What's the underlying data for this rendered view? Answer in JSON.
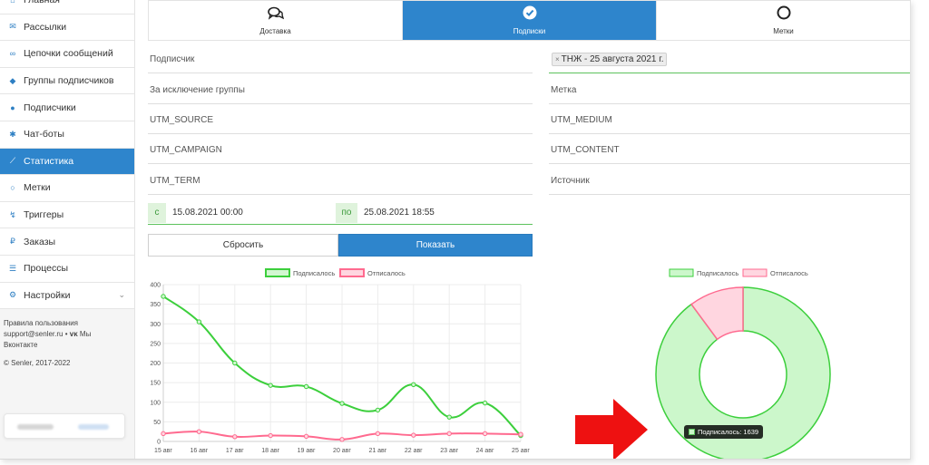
{
  "sidebar": {
    "items": [
      {
        "label": "Главная",
        "icon": "home-icon",
        "glyph": "⌂"
      },
      {
        "label": "Рассылки",
        "icon": "envelope-icon",
        "glyph": "✉"
      },
      {
        "label": "Цепочки сообщений",
        "icon": "link-icon",
        "glyph": "∞"
      },
      {
        "label": "Группы подписчиков",
        "icon": "tags-icon",
        "glyph": "◆"
      },
      {
        "label": "Подписчики",
        "icon": "users-icon",
        "glyph": "●"
      },
      {
        "label": "Чат-боты",
        "icon": "bot-icon",
        "glyph": "✱"
      },
      {
        "label": "Статистика",
        "icon": "chart-line-icon",
        "glyph": "⟋"
      },
      {
        "label": "Метки",
        "icon": "circle-icon",
        "glyph": "○"
      },
      {
        "label": "Триггеры",
        "icon": "bolt-icon",
        "glyph": "↯"
      },
      {
        "label": "Заказы",
        "icon": "ruble-icon",
        "glyph": "₽"
      },
      {
        "label": "Процессы",
        "icon": "list-icon",
        "glyph": "☰"
      },
      {
        "label": "Настройки",
        "icon": "gear-icon",
        "glyph": "⚙"
      }
    ],
    "settings_chevron": "⌄",
    "footer": {
      "terms": "Правила пользования",
      "support": "support@senler.ru",
      "vk_sep": " • ",
      "vk_icon": "vk-icon",
      "vk_text": "Мы",
      "vk_text2": "Вконтакте",
      "copyright": "© Senler, 2017-2022"
    }
  },
  "tabs": [
    {
      "label": "Доставка",
      "icon": "comments-icon",
      "glyph": "💬",
      "active": false
    },
    {
      "label": "Подписки",
      "icon": "check-circle-icon",
      "glyph": "✔",
      "active": true
    },
    {
      "label": "Метки",
      "icon": "circle-outline-icon",
      "glyph": "○",
      "active": false
    }
  ],
  "filters": {
    "subscriber": "Подписчик",
    "group_chip": "ТНЖ - 25 августа 2021 г.",
    "exclude_group": "За исключение группы",
    "tag": "Метка",
    "utm_source": "UTM_SOURCE",
    "utm_medium": "UTM_MEDIUM",
    "utm_campaign": "UTM_CAMPAIGN",
    "utm_content": "UTM_CONTENT",
    "utm_term": "UTM_TERM",
    "source": "Источник"
  },
  "dates": {
    "from_label": "с",
    "from_value": "15.08.2021 00:00",
    "to_label": "по",
    "to_value": "25.08.2021 18:55"
  },
  "buttons": {
    "reset": "Сбросить",
    "show": "Показать"
  },
  "colors": {
    "accent": "#2e85cc",
    "subscribed": "#3ccf3c",
    "unsubscribed": "#ff6a8f",
    "arrow": "#ee1111"
  },
  "tooltip": {
    "text": "Подписалось: 1639"
  },
  "chart_data": [
    {
      "type": "line",
      "x": [
        "15 авг",
        "16 авг",
        "17 авг",
        "18 авг",
        "19 авг",
        "20 авг",
        "21 авг",
        "22 авг",
        "23 авг",
        "24 авг",
        "25 авг"
      ],
      "series": [
        {
          "name": "Подписалось",
          "values": [
            370,
            305,
            200,
            143,
            140,
            97,
            80,
            145,
            62,
            98,
            15
          ]
        },
        {
          "name": "Отписалось",
          "values": [
            20,
            25,
            12,
            15,
            13,
            5,
            20,
            16,
            20,
            20,
            18
          ]
        }
      ],
      "yticks": [
        "0",
        "50",
        "100",
        "150",
        "200",
        "250",
        "300",
        "350",
        "400"
      ],
      "ylim": [
        0,
        400
      ],
      "grid": true,
      "legend": "top"
    },
    {
      "type": "pie",
      "categories": [
        "Подписалось",
        "Отписалось"
      ],
      "values": [
        1639,
        184
      ],
      "legend": "top"
    }
  ]
}
